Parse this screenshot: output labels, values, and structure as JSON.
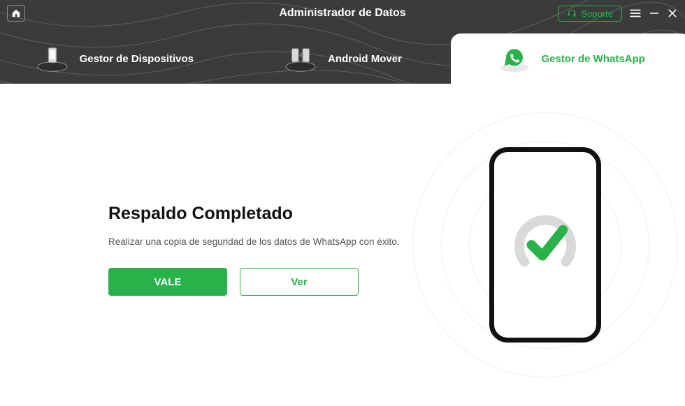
{
  "app": {
    "title": "Administrador de Datos",
    "support_label": "Soporte"
  },
  "tabs": {
    "items": [
      {
        "label": "Gestor de Dispositivos"
      },
      {
        "label": "Android Mover"
      },
      {
        "label": "Gestor de WhatsApp"
      }
    ]
  },
  "content": {
    "title": "Respaldo Completado",
    "subtitle": "Realizar una copia de seguridad de los datos de WhatsApp con éxito.",
    "primary_button": "VALE",
    "secondary_button": "Ver"
  },
  "colors": {
    "accent": "#29b24a"
  }
}
